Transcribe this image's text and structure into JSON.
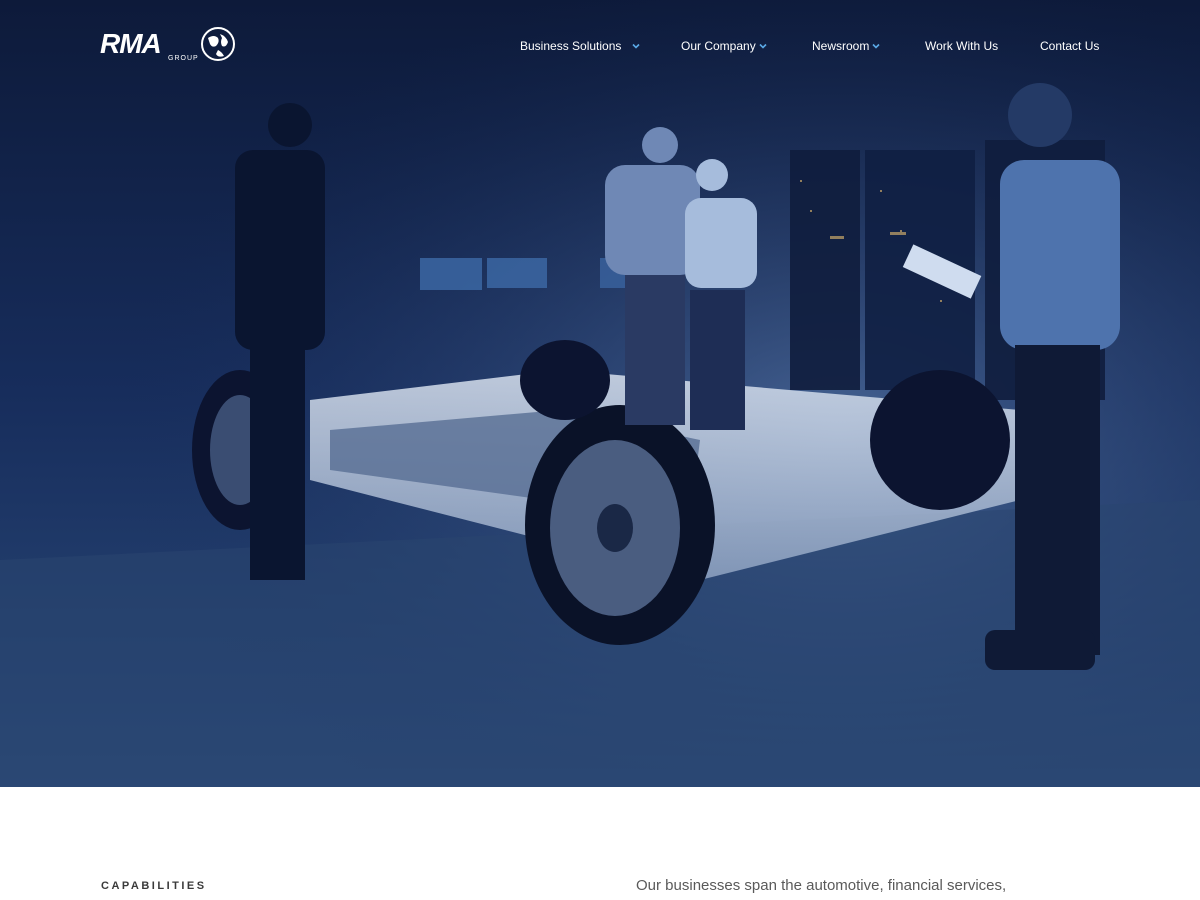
{
  "brand": {
    "logo_text": "RMA",
    "logo_subtext": "GROUP"
  },
  "nav": {
    "items": [
      {
        "label": "Business Solutions",
        "has_dropdown": true
      },
      {
        "label": "Our Company",
        "has_dropdown": true
      },
      {
        "label": "Newsroom",
        "has_dropdown": true
      },
      {
        "label": "Work With Us",
        "has_dropdown": false
      },
      {
        "label": "Contact Us",
        "has_dropdown": false
      }
    ]
  },
  "hero": {
    "image_subject": "engineers-inspecting-ev-chassis"
  },
  "section": {
    "eyebrow": "CAPABILITIES",
    "lede": "Our businesses span the automotive, financial services,"
  },
  "colors": {
    "hero_dark": "#0f1f44",
    "hero_mid": "#1c3566",
    "accent_chevron": "#5aa9e6",
    "text_dark": "#3a3a3a",
    "text_muted": "#5a5a5a"
  }
}
